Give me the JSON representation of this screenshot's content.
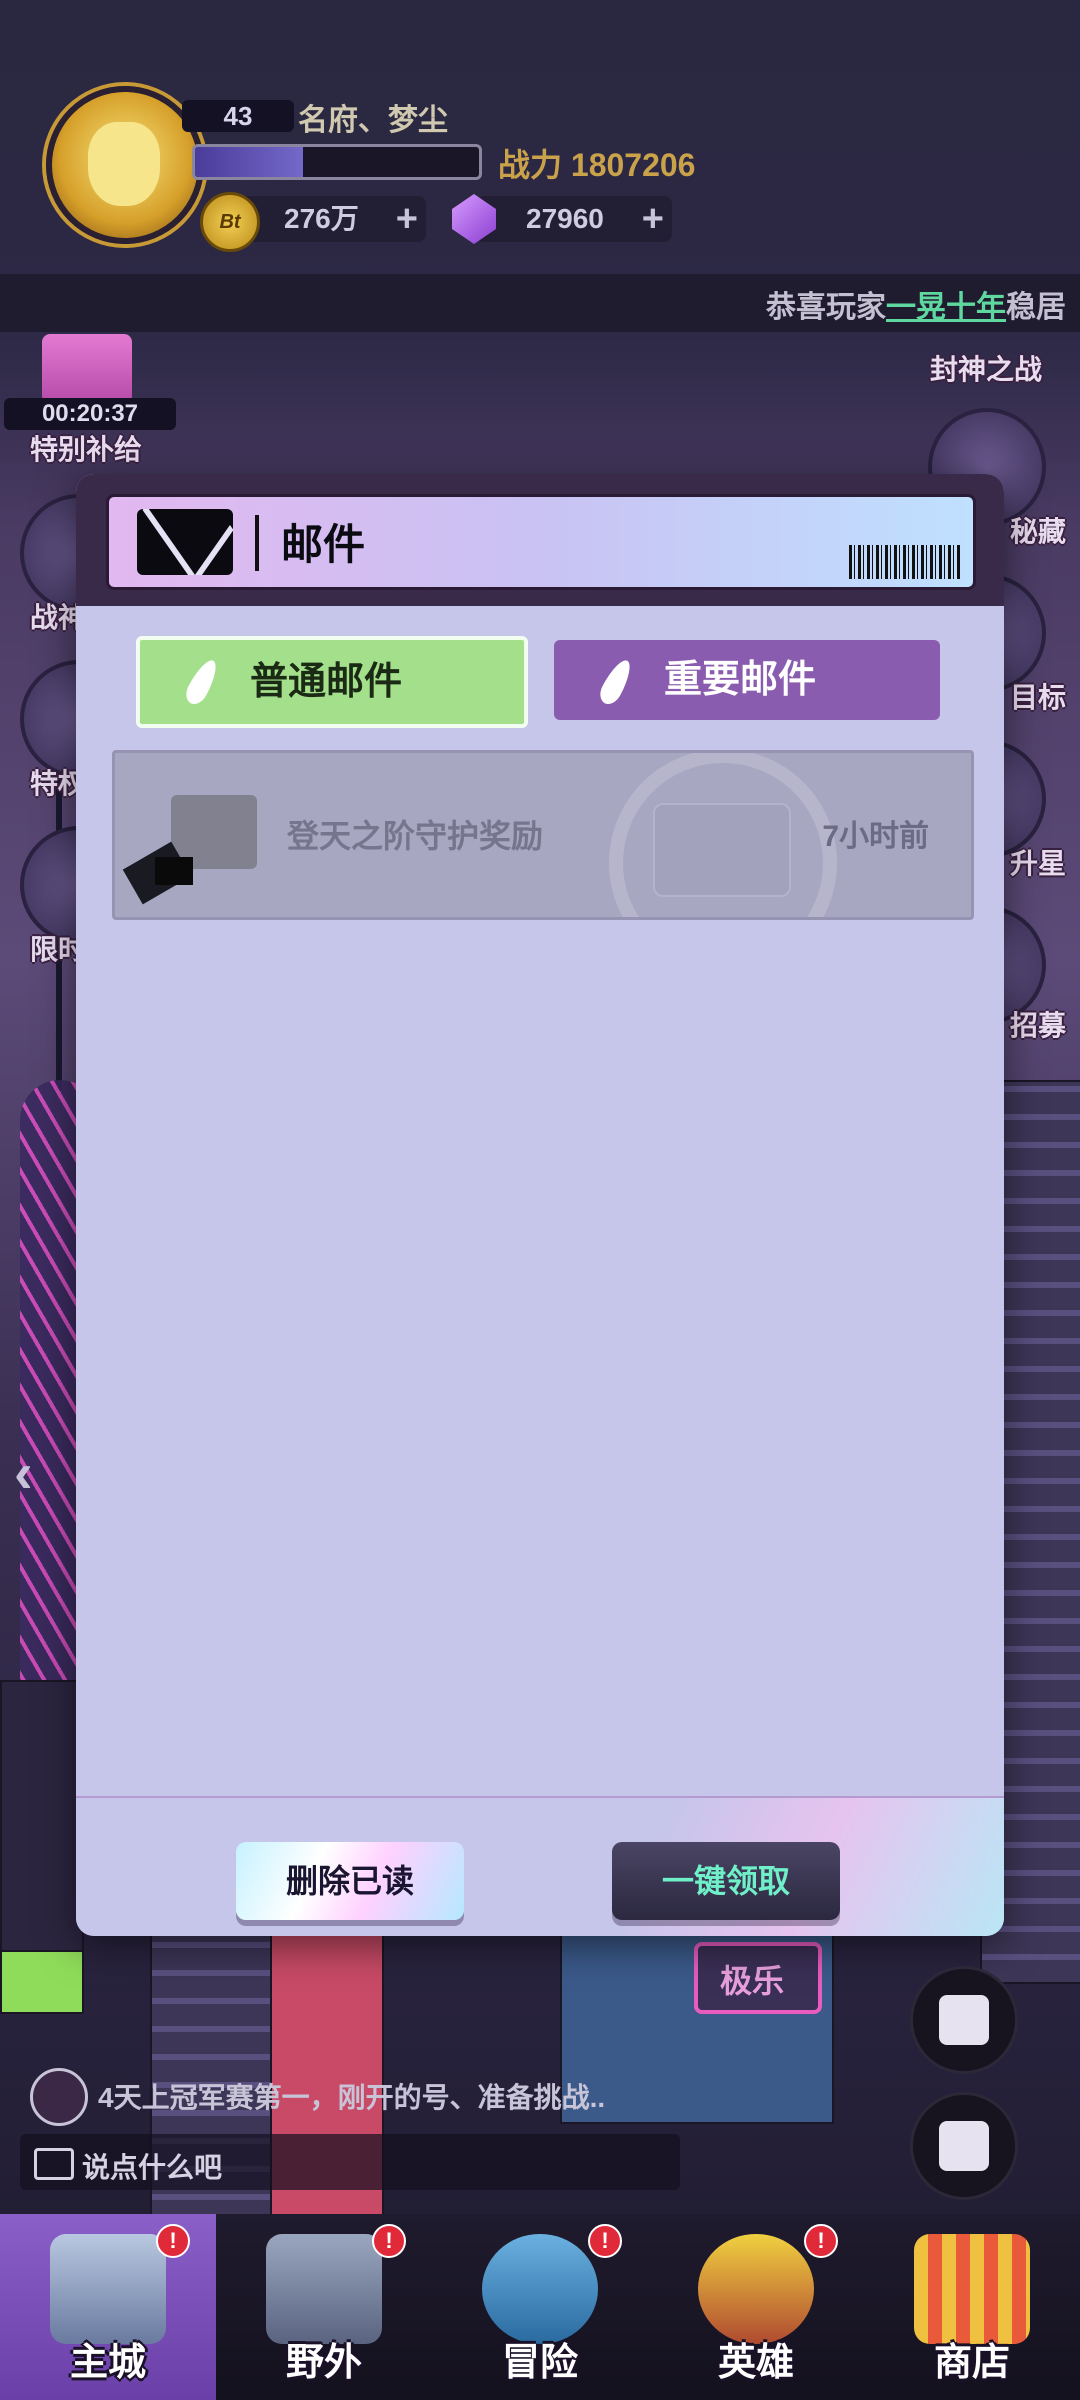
{
  "player": {
    "level": "43",
    "name": "名府、梦尘",
    "xp_fraction": 0.38,
    "power": "战力 1807206",
    "coin_label": "Bt",
    "coins": "276万",
    "gems": "27960",
    "plus": "+"
  },
  "ticker": {
    "prefix": "恭喜玩家",
    "highlight": "一晃十年",
    "suffix": "稳居"
  },
  "side_left": {
    "timer": "00:20:37",
    "items": [
      "特别补给",
      "战神",
      "特权",
      "限时"
    ]
  },
  "side_right": {
    "items": [
      "封神之战",
      "秘藏",
      "目标",
      "升星",
      "招募"
    ]
  },
  "mail_dialog": {
    "title": "邮件",
    "tabs": {
      "normal": "普通邮件",
      "important": "重要邮件"
    },
    "mails": [
      {
        "subject": "登天之阶守护奖励",
        "time": "7小时前"
      }
    ],
    "buttons": {
      "delete_read": "删除已读",
      "claim_all": "一键领取"
    }
  },
  "chat": {
    "message": "4天上冠军赛第一，刚开的号、准备挑战..",
    "placeholder": "说点什么吧"
  },
  "city_sign": "极乐",
  "bottom_nav": {
    "items": [
      {
        "label": "主城",
        "badge": "!"
      },
      {
        "label": "野外",
        "badge": "!"
      },
      {
        "label": "冒险",
        "badge": "!"
      },
      {
        "label": "英雄",
        "badge": "!"
      },
      {
        "label": "商店",
        "badge": ""
      }
    ]
  },
  "colors": {
    "tab_normal": "#a4e08c",
    "tab_important": "#8a5cb0",
    "claim_text": "#6ff0c8",
    "ticker_highlight": "#5fd8a0"
  },
  "icons": [
    "mail-icon",
    "quill-icon",
    "gift-icon",
    "coin-icon",
    "gem-icon",
    "chat-bubble-icon"
  ]
}
